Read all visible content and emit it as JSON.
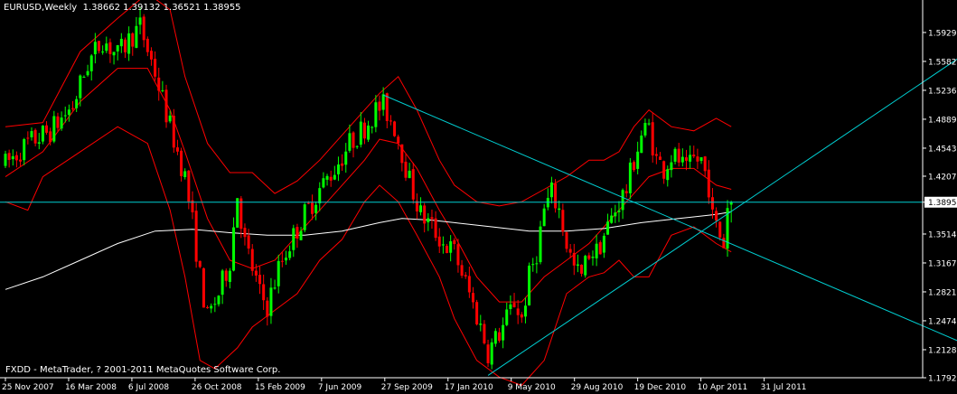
{
  "header": {
    "symbol": "EURUSD,Weekly",
    "ohlc": "1.38662 1.39132 1.36521 1.38955"
  },
  "copyright": "FXDD - MetaTrader, ? 2001-2011 MetaQuotes Software Corp.",
  "colors": {
    "background": "#000000",
    "frame": "#ffffff",
    "bull": "#00ff00",
    "bear": "#ff0000",
    "bands": "#ff0000",
    "ma": "#ffffff",
    "trendline": "#00ced1",
    "current_price_bg": "#ffffff",
    "current_price_text": "#000000"
  },
  "chart_data": {
    "type": "candlestick",
    "y_ticks": [
      "1.59290",
      "1.55825",
      "1.52360",
      "1.48895",
      "1.45430",
      "1.42070",
      "1.38955",
      "1.35140",
      "1.31675",
      "1.28210",
      "1.24745",
      "1.21280",
      "1.17920"
    ],
    "ylim": [
      1.1792,
      1.6275
    ],
    "x_ticks": [
      "25 Nov 2007",
      "16 Mar 2008",
      "6 Jul 2008",
      "26 Oct 2008",
      "15 Feb 2009",
      "7 Jun 2009",
      "27 Sep 2009",
      "17 Jan 2010",
      "9 May 2010",
      "29 Aug 2010",
      "19 Dec 2010",
      "10 Apr 2011",
      "31 Jul 2011"
    ],
    "current_price": 1.38955,
    "last_bar": {
      "open": 1.38662,
      "high": 1.39132,
      "low": 1.36521,
      "close": 1.38955
    },
    "close_path": [
      [
        0,
        1.435
      ],
      [
        6,
        1.46
      ],
      [
        12,
        1.475
      ],
      [
        18,
        1.505
      ],
      [
        22,
        1.555
      ],
      [
        26,
        1.585
      ],
      [
        30,
        1.565
      ],
      [
        34,
        1.59
      ],
      [
        36,
        1.6
      ],
      [
        40,
        1.545
      ],
      [
        44,
        1.48
      ],
      [
        48,
        1.42
      ],
      [
        50,
        1.365
      ],
      [
        52,
        1.3
      ],
      [
        54,
        1.25
      ],
      [
        57,
        1.28
      ],
      [
        60,
        1.32
      ],
      [
        62,
        1.4
      ],
      [
        64,
        1.34
      ],
      [
        68,
        1.28
      ],
      [
        70,
        1.265
      ],
      [
        73,
        1.31
      ],
      [
        76,
        1.34
      ],
      [
        80,
        1.375
      ],
      [
        84,
        1.405
      ],
      [
        88,
        1.43
      ],
      [
        92,
        1.46
      ],
      [
        96,
        1.48
      ],
      [
        99,
        1.5
      ],
      [
        101,
        1.505
      ],
      [
        104,
        1.48
      ],
      [
        106,
        1.45
      ],
      [
        108,
        1.415
      ],
      [
        111,
        1.375
      ],
      [
        114,
        1.36
      ],
      [
        117,
        1.34
      ],
      [
        120,
        1.33
      ],
      [
        124,
        1.28
      ],
      [
        127,
        1.24
      ],
      [
        129,
        1.21
      ],
      [
        131,
        1.225
      ],
      [
        133,
        1.24
      ],
      [
        136,
        1.27
      ],
      [
        138,
        1.25
      ],
      [
        140,
        1.3
      ],
      [
        142,
        1.33
      ],
      [
        144,
        1.38
      ],
      [
        146,
        1.4
      ],
      [
        148,
        1.38
      ],
      [
        150,
        1.34
      ],
      [
        152,
        1.31
      ],
      [
        154,
        1.3
      ],
      [
        156,
        1.33
      ],
      [
        158,
        1.33
      ],
      [
        160,
        1.35
      ],
      [
        162,
        1.37
      ],
      [
        164,
        1.39
      ],
      [
        166,
        1.405
      ],
      [
        168,
        1.44
      ],
      [
        170,
        1.47
      ],
      [
        172,
        1.48
      ],
      [
        174,
        1.44
      ],
      [
        176,
        1.43
      ],
      [
        178,
        1.445
      ],
      [
        180,
        1.44
      ],
      [
        182,
        1.425
      ],
      [
        184,
        1.44
      ],
      [
        186,
        1.44
      ],
      [
        188,
        1.41
      ],
      [
        189,
        1.37
      ],
      [
        191,
        1.35
      ],
      [
        192,
        1.34
      ],
      [
        193,
        1.385
      ],
      [
        194,
        1.38955
      ]
    ],
    "upper_band": [
      [
        0,
        1.48
      ],
      [
        10,
        1.485
      ],
      [
        20,
        1.57
      ],
      [
        30,
        1.61
      ],
      [
        38,
        1.64
      ],
      [
        44,
        1.62
      ],
      [
        48,
        1.54
      ],
      [
        54,
        1.46
      ],
      [
        60,
        1.425
      ],
      [
        66,
        1.425
      ],
      [
        72,
        1.4
      ],
      [
        78,
        1.415
      ],
      [
        84,
        1.44
      ],
      [
        90,
        1.47
      ],
      [
        96,
        1.5
      ],
      [
        100,
        1.52
      ],
      [
        105,
        1.54
      ],
      [
        110,
        1.5
      ],
      [
        116,
        1.44
      ],
      [
        120,
        1.41
      ],
      [
        126,
        1.39
      ],
      [
        132,
        1.385
      ],
      [
        138,
        1.39
      ],
      [
        144,
        1.405
      ],
      [
        150,
        1.42
      ],
      [
        156,
        1.44
      ],
      [
        160,
        1.44
      ],
      [
        164,
        1.45
      ],
      [
        168,
        1.48
      ],
      [
        172,
        1.5
      ],
      [
        178,
        1.48
      ],
      [
        184,
        1.475
      ],
      [
        190,
        1.49
      ],
      [
        194,
        1.48
      ]
    ],
    "mid_band": [
      [
        0,
        1.42
      ],
      [
        10,
        1.45
      ],
      [
        20,
        1.51
      ],
      [
        30,
        1.55
      ],
      [
        38,
        1.55
      ],
      [
        44,
        1.5
      ],
      [
        48,
        1.45
      ],
      [
        54,
        1.37
      ],
      [
        60,
        1.32
      ],
      [
        66,
        1.31
      ],
      [
        72,
        1.32
      ],
      [
        78,
        1.35
      ],
      [
        84,
        1.38
      ],
      [
        90,
        1.41
      ],
      [
        96,
        1.44
      ],
      [
        100,
        1.465
      ],
      [
        105,
        1.46
      ],
      [
        110,
        1.43
      ],
      [
        116,
        1.38
      ],
      [
        120,
        1.35
      ],
      [
        126,
        1.3
      ],
      [
        132,
        1.27
      ],
      [
        138,
        1.27
      ],
      [
        144,
        1.3
      ],
      [
        150,
        1.32
      ],
      [
        156,
        1.34
      ],
      [
        160,
        1.36
      ],
      [
        164,
        1.38
      ],
      [
        168,
        1.4
      ],
      [
        172,
        1.42
      ],
      [
        178,
        1.43
      ],
      [
        184,
        1.43
      ],
      [
        190,
        1.41
      ],
      [
        194,
        1.405
      ]
    ],
    "lower_band": [
      [
        0,
        1.39
      ],
      [
        6,
        1.38
      ],
      [
        10,
        1.42
      ],
      [
        20,
        1.45
      ],
      [
        30,
        1.48
      ],
      [
        38,
        1.46
      ],
      [
        44,
        1.38
      ],
      [
        48,
        1.3
      ],
      [
        52,
        1.2
      ],
      [
        56,
        1.19
      ],
      [
        62,
        1.215
      ],
      [
        66,
        1.24
      ],
      [
        72,
        1.26
      ],
      [
        78,
        1.28
      ],
      [
        84,
        1.32
      ],
      [
        90,
        1.345
      ],
      [
        96,
        1.39
      ],
      [
        100,
        1.41
      ],
      [
        105,
        1.39
      ],
      [
        110,
        1.35
      ],
      [
        116,
        1.3
      ],
      [
        120,
        1.25
      ],
      [
        126,
        1.2
      ],
      [
        132,
        1.18
      ],
      [
        138,
        1.17
      ],
      [
        144,
        1.2
      ],
      [
        150,
        1.28
      ],
      [
        156,
        1.3
      ],
      [
        160,
        1.305
      ],
      [
        164,
        1.32
      ],
      [
        168,
        1.3
      ],
      [
        172,
        1.3
      ],
      [
        178,
        1.35
      ],
      [
        184,
        1.36
      ],
      [
        190,
        1.34
      ],
      [
        194,
        1.33
      ]
    ],
    "ma_line": [
      [
        0,
        1.285
      ],
      [
        10,
        1.3
      ],
      [
        20,
        1.32
      ],
      [
        30,
        1.34
      ],
      [
        40,
        1.355
      ],
      [
        50,
        1.357
      ],
      [
        60,
        1.353
      ],
      [
        70,
        1.35
      ],
      [
        80,
        1.35
      ],
      [
        90,
        1.355
      ],
      [
        100,
        1.365
      ],
      [
        106,
        1.37
      ],
      [
        114,
        1.368
      ],
      [
        120,
        1.365
      ],
      [
        130,
        1.36
      ],
      [
        140,
        1.355
      ],
      [
        150,
        1.355
      ],
      [
        160,
        1.358
      ],
      [
        170,
        1.365
      ],
      [
        180,
        1.37
      ],
      [
        190,
        1.375
      ],
      [
        194,
        1.378
      ]
    ],
    "trendlines": [
      {
        "from": [
          101,
          1.518
        ],
        "to": [
          260,
          1.213
        ]
      },
      {
        "from": [
          129,
          1.182
        ],
        "to": [
          260,
          1.578
        ]
      }
    ],
    "grid": false,
    "legend": "none"
  }
}
